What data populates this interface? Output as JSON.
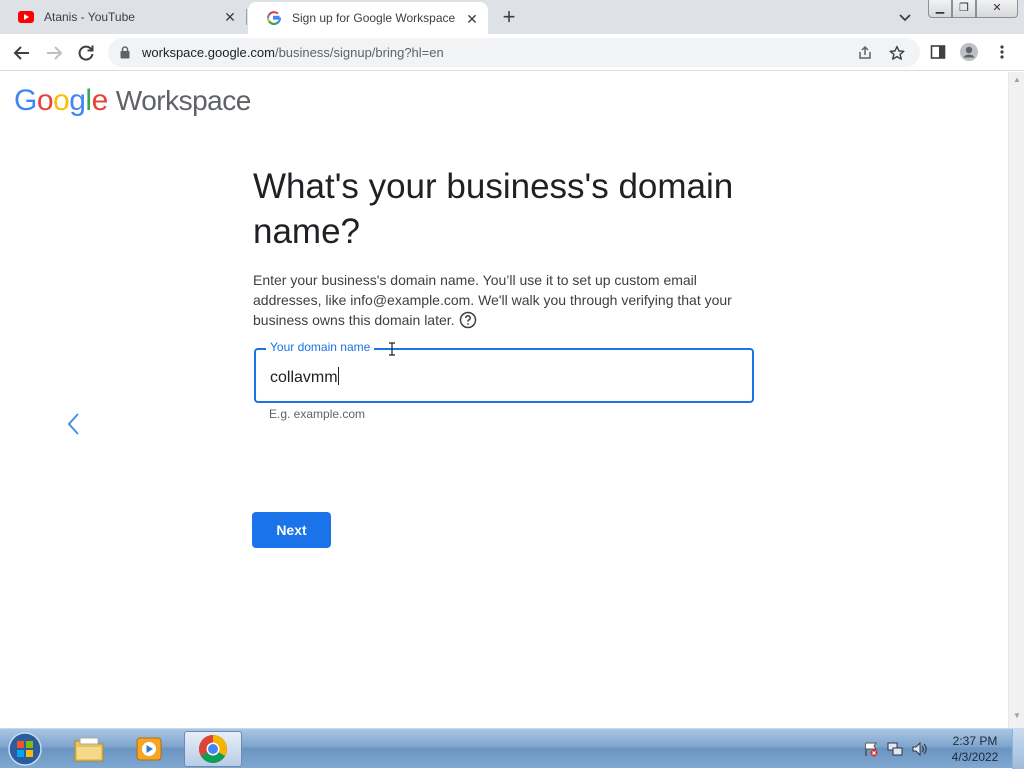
{
  "browser": {
    "tabs": [
      {
        "title": "Atanis - YouTube",
        "favicon": "youtube-icon"
      },
      {
        "title": "Sign up for Google Workspace",
        "favicon": "google-g-icon",
        "active": true
      }
    ],
    "url_host": "workspace.google.com",
    "url_path": "/business/signup/bring?hl=en"
  },
  "page": {
    "logo_letters": [
      "G",
      "o",
      "o",
      "g",
      "l",
      "e"
    ],
    "logo_product": "Workspace",
    "heading": "What's your business's domain name?",
    "description": "Enter your business's domain name. You’ll use it to set up custom email addresses, like info@example.com. We'll walk you through verifying that your business owns this domain later.",
    "field_label": "Your domain name",
    "field_value": "collavmm",
    "field_hint": "E.g. example.com",
    "next_label": "Next"
  },
  "taskbar": {
    "time": "2:37 PM",
    "date": "4/3/2022"
  },
  "colors": {
    "accent": "#1a73e8",
    "google_blue": "#4285f4",
    "google_red": "#ea4335",
    "google_yellow": "#fbbc05",
    "google_green": "#34a853"
  }
}
